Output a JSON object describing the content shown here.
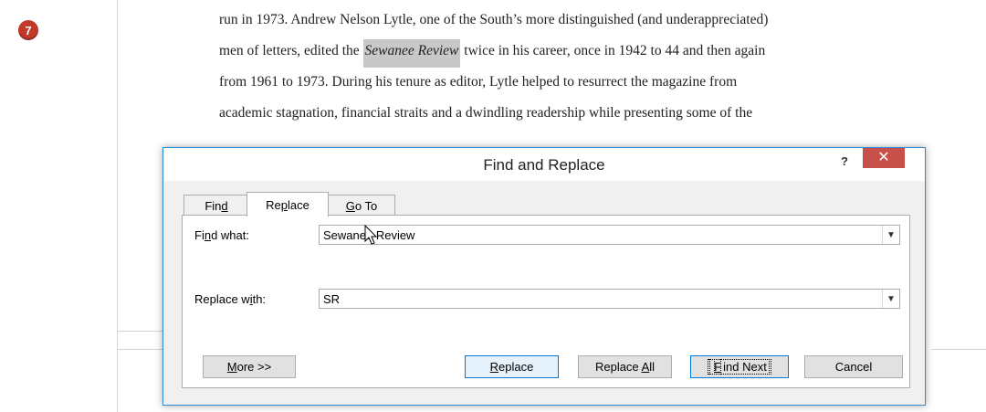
{
  "step_number": "7",
  "document": {
    "lines": [
      {
        "text": "run in 1973. Andrew Nelson Lytle, one of the South’s more distinguished (and underappreciated)"
      },
      {
        "before": "men of letters, edited the ",
        "highlight": "Sewanee Review",
        "after": " twice in his career, once in 1942 to 44 and then again"
      },
      {
        "text": "from 1961 to 1973. During his tenure as editor, Lytle helped to resurrect the magazine from"
      },
      {
        "text": "academic stagnation, financial straits and a dwindling readership while presenting some of the"
      }
    ]
  },
  "dialog": {
    "title": "Find and Replace",
    "help_label": "?",
    "close_label": "✕",
    "tabs": [
      {
        "label_pre": "Fin",
        "label_key": "d",
        "label_post": "",
        "active": false
      },
      {
        "label_pre": "Re",
        "label_key": "p",
        "label_post": "lace",
        "active": true
      },
      {
        "label_pre": "",
        "label_key": "G",
        "label_post": "o To",
        "active": false
      }
    ],
    "find_label_pre": "Fi",
    "find_label_key": "n",
    "find_label_post": "d what:",
    "find_value": "Sewanee Review",
    "replace_label_pre": "Replace w",
    "replace_label_key": "i",
    "replace_label_post": "th:",
    "replace_value": "SR",
    "combo_arrow": "⌵",
    "buttons": {
      "more_key": "M",
      "more_rest": "ore >>",
      "replace_pre": "",
      "replace_key": "R",
      "replace_post": "eplace",
      "replace_all_pre": "Replace ",
      "replace_all_key": "A",
      "replace_all_post": "ll",
      "find_next_pre": "",
      "find_next_key": "F",
      "find_next_post": "ind Next",
      "cancel": "Cancel"
    }
  },
  "colors": {
    "step_badge": "#c0392b",
    "close_button": "#c7504a",
    "dialog_border": "#2a8dd4",
    "highlight": "#c8c8c8"
  }
}
